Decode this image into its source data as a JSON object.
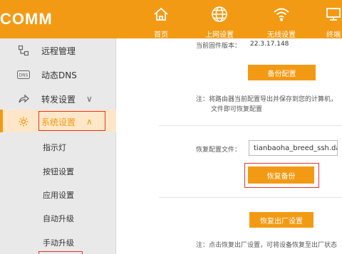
{
  "brand": "COMM",
  "nav": [
    {
      "label": "首页",
      "icon": "home-icon"
    },
    {
      "label": "上网设置",
      "icon": "globe-icon"
    },
    {
      "label": "无线设置",
      "icon": "wifi-icon"
    },
    {
      "label": "终端",
      "icon": "monitor-icon"
    }
  ],
  "sidebar": {
    "items": [
      {
        "label": "远程管理",
        "icon": "remote-icon"
      },
      {
        "label": "动态DNS",
        "icon": "dns-icon"
      },
      {
        "label": "转发设置",
        "icon": "forward-icon",
        "chevron": "∨"
      },
      {
        "label": "系统设置",
        "icon": "gear-icon",
        "chevron": "∧"
      }
    ],
    "sub_items": [
      "指示灯",
      "按钮设置",
      "应用设置",
      "自动升级",
      "手动升级"
    ]
  },
  "main": {
    "firmware_label": "当前固件版本：",
    "firmware_version": "22.3.17.148",
    "backup_button": "备份配置",
    "backup_note_1": "注：将路由器当前配置导出并保存到您的计算机，",
    "backup_note_2": "文件即可恢复配置",
    "restore_label": "恢复配置文件：",
    "restore_file": "tianbaoha_breed_ssh.dat",
    "restore_button": "恢复备份",
    "factory_button": "恢复出厂设置",
    "factory_note": "注：点击恢复出厂设置，可将设备恢复至出厂状态"
  },
  "colors": {
    "accent": "#f39a14",
    "highlight": "#e3342f"
  }
}
